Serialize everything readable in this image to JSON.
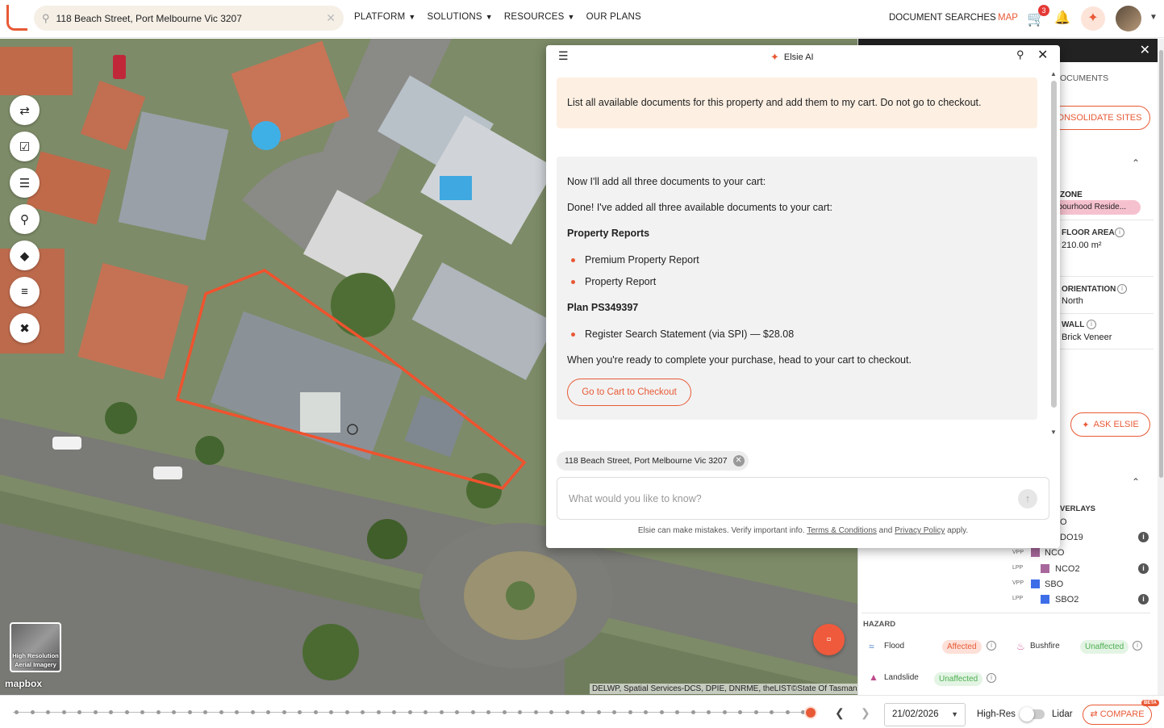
{
  "header": {
    "search_value": "118 Beach Street, Port Melbourne Vic 3207",
    "nav": [
      {
        "label": "PLATFORM",
        "has_menu": true
      },
      {
        "label": "SOLUTIONS",
        "has_menu": true
      },
      {
        "label": "RESOURCES",
        "has_menu": true
      },
      {
        "label": "OUR PLANS",
        "has_menu": false
      }
    ],
    "document_searches": "DOCUMENT SEARCHES",
    "map": "MAP",
    "cart_count": "3"
  },
  "map": {
    "hires_thumb_label_1": "High Resolution",
    "hires_thumb_label_2": "Aerial Imagery",
    "mapbox": "mapbox",
    "attribution": "DELWP, Spatial Services-DCS, DPIE, DNRME, theLIST©State Of Tasmania,",
    "tools": [
      "collapse-icon",
      "checklist-icon",
      "clipboard-icon",
      "pin-search-icon",
      "layers-icon",
      "list-icon",
      "tools-icon"
    ]
  },
  "elsie": {
    "title": "Elsie AI",
    "user_message": "List all available documents for this property and add them to my cart. Do not go to checkout.",
    "ai_lines": {
      "l1": "Now I'll add all three documents to your cart:",
      "l2": "Done! I've added all three available documents to your cart:",
      "h1": "Property Reports",
      "b1": "Premium Property Report",
      "b2": "Property Report",
      "h2": "Plan PS349397",
      "b3": "Register Search Statement (via SPI) — $28.08",
      "l3": "When you're ready to complete your purchase, head to your cart to checkout."
    },
    "cart_button": "Go to Cart to Checkout",
    "chip": "118 Beach Street, Port Melbourne Vic 3207",
    "input_placeholder": "What would you like to know?",
    "disclaimer_pre": "Elsie can make mistakes. Verify important info. ",
    "terms": "Terms & Conditions",
    "and": " and ",
    "privacy": "Privacy Policy",
    "apply": " apply."
  },
  "panel": {
    "documents": "OCUMENTS",
    "consolidate": "ONSOLIDATE SITES",
    "zone_label": "ZONE",
    "zone_value": "hbourhood Reside...",
    "floor_area_label": "FLOOR AREA",
    "floor_area_value": "210.00 m²",
    "orientation_label": "ORIENTATION",
    "orientation_value": "North",
    "wall_label": "WALL",
    "wall_value": "Brick Veneer",
    "ask_elsie": "ASK ELSIE",
    "overlays_label": "VERLAYS",
    "overlay_partial_1": "O",
    "overlay_partial_2": "DO19",
    "overlays": [
      {
        "kind": "VPP",
        "code": "NCO",
        "color": "#a7679b"
      },
      {
        "kind": "LPP",
        "code": "NCO2",
        "color": "#a7679b"
      },
      {
        "kind": "VPP",
        "code": "SBO",
        "color": "#3d6ee8"
      },
      {
        "kind": "LPP",
        "code": "SBO2",
        "color": "#3d6ee8"
      }
    ],
    "hazard_label": "HAZARD",
    "hazards": [
      {
        "name": "Flood",
        "status": "Affected"
      },
      {
        "name": "Bushfire",
        "status": "Unaffected"
      },
      {
        "name": "Landslide",
        "status": "Unaffected"
      }
    ]
  },
  "timeline": {
    "date": "21/02/2026",
    "high_res": "High-Res",
    "lidar": "Lidar",
    "compare": "COMPARE",
    "beta": "BETA"
  },
  "colors": {
    "accent": "#e85a36",
    "parcel": "#f0522e"
  }
}
